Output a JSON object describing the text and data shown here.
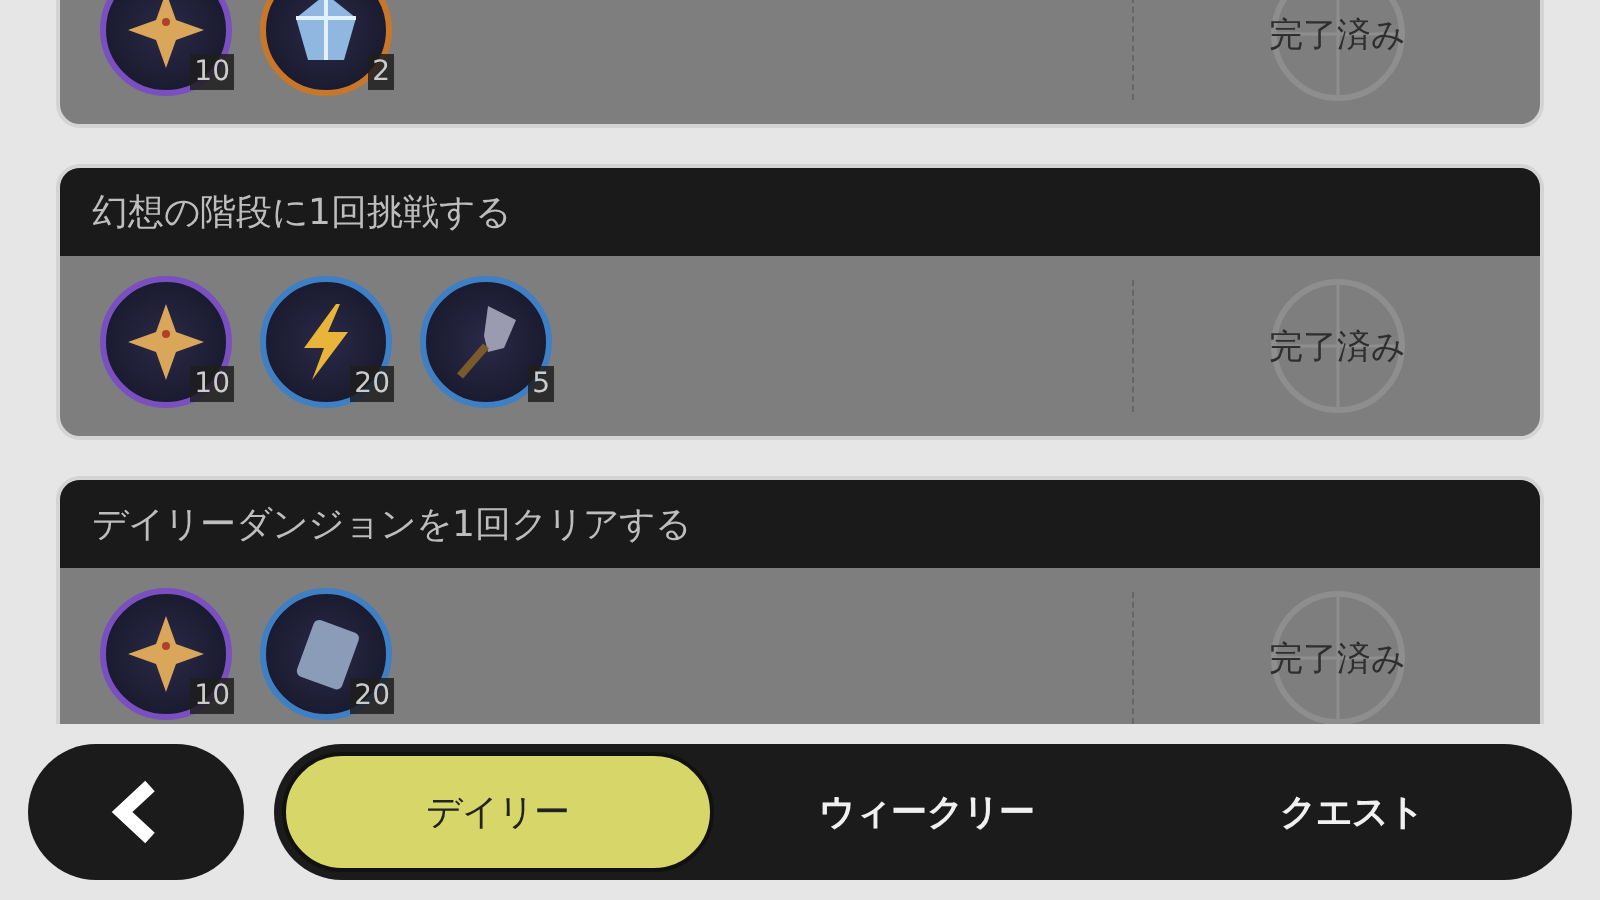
{
  "missions": [
    {
      "completed": true,
      "rewards": [
        {
          "kind": "shard",
          "color": "#7a4fc0",
          "count": "10"
        },
        {
          "kind": "crystal",
          "color": "#c8772a",
          "count": "2"
        }
      ],
      "status": "完了済み"
    },
    {
      "title": "幻想の階段に1回挑戦する",
      "completed": true,
      "rewards": [
        {
          "kind": "shard",
          "color": "#7a4fc0",
          "count": "10"
        },
        {
          "kind": "lightning",
          "color": "#3f7fc4",
          "count": "20"
        },
        {
          "kind": "shovel",
          "color": "#3f7fc4",
          "count": "5"
        }
      ],
      "status": "完了済み"
    },
    {
      "title": "デイリーダンジョンを1回クリアする",
      "completed": true,
      "rewards": [
        {
          "kind": "shard",
          "color": "#7a4fc0",
          "count": "10"
        },
        {
          "kind": "card",
          "color": "#3f7fc4",
          "count": "20"
        }
      ],
      "status": "完了済み"
    }
  ],
  "tabs": [
    {
      "label": "デイリー",
      "selected": true
    },
    {
      "label": "ウィークリー",
      "selected": false
    },
    {
      "label": "クエスト",
      "selected": false
    }
  ]
}
